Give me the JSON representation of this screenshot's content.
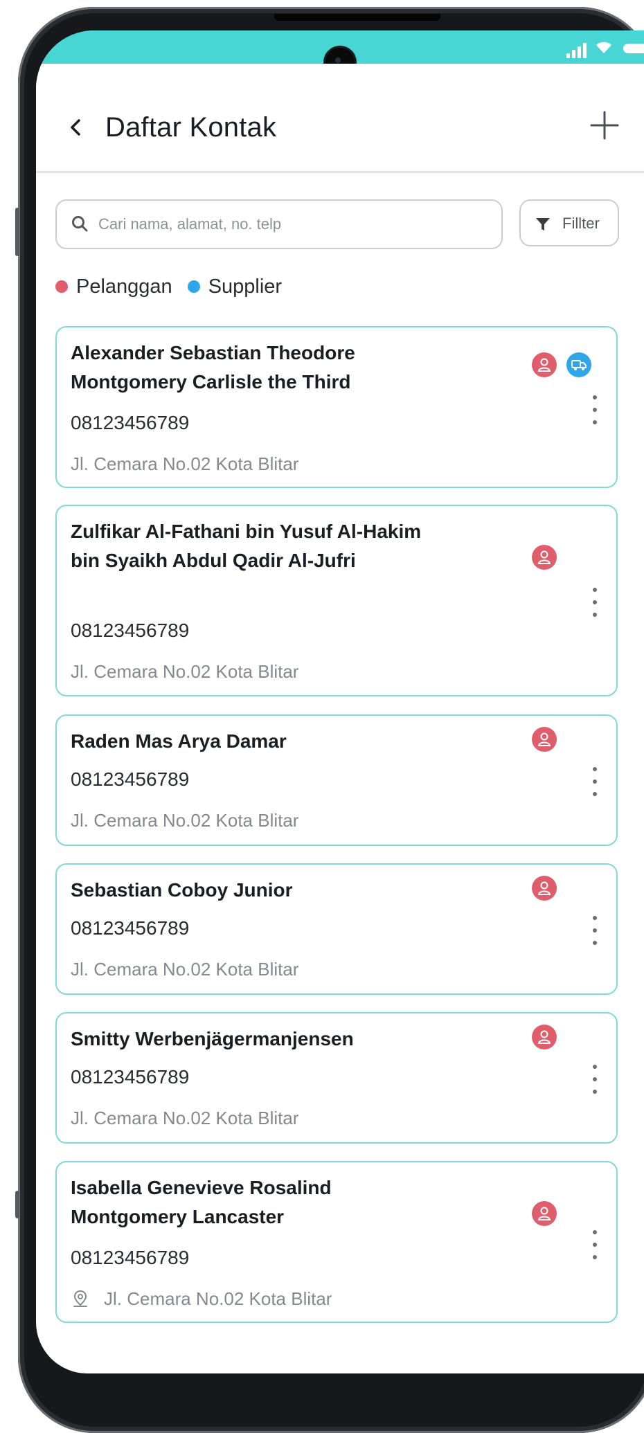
{
  "header": {
    "title": "Daftar Kontak"
  },
  "search": {
    "placeholder": "Cari nama, alamat, no. telp"
  },
  "filter": {
    "label": "Fillter"
  },
  "legend": [
    {
      "label": "Pelanggan",
      "color": "#e05d6c"
    },
    {
      "label": "Supplier",
      "color": "#2fa6ea"
    }
  ],
  "contacts": [
    {
      "name": "Alexander Sebastian Theodore Montgomery Carlisle the Third",
      "phone": "08123456789",
      "address": "Jl. Cemara No.02 Kota Blitar",
      "badges": [
        "pelanggan",
        "supplier"
      ]
    },
    {
      "name": "Zulfikar Al-Fathani bin Yusuf Al-Hakim bin Syaikh Abdul Qadir Al-Jufri",
      "phone": "08123456789",
      "address": "Jl. Cemara No.02 Kota Blitar",
      "badges": [
        "pelanggan"
      ]
    },
    {
      "name": "Raden Mas Arya Damar",
      "phone": "08123456789",
      "address": "Jl. Cemara No.02 Kota Blitar",
      "badges": [
        "pelanggan"
      ]
    },
    {
      "name": "Sebastian Coboy Junior",
      "phone": "08123456789",
      "address": "Jl. Cemara No.02 Kota Blitar",
      "badges": [
        "pelanggan"
      ]
    },
    {
      "name": "Smitty Werbenjägermanjensen",
      "phone": "08123456789",
      "address": "Jl. Cemara No.02 Kota Blitar",
      "badges": [
        "pelanggan"
      ]
    },
    {
      "name": "Isabella Genevieve Rosalind Montgomery Lancaster",
      "phone": "08123456789",
      "address": "Jl. Cemara No.02 Kota Blitar",
      "badges": [
        "pelanggan"
      ]
    }
  ],
  "icons": {
    "back": "chevron-left-icon",
    "add": "plus-icon",
    "search": "search-icon",
    "filter": "funnel-icon",
    "pelanggan": "user-icon",
    "supplier": "truck-icon",
    "menu": "more-vertical-icon",
    "location": "location-pin-icon"
  }
}
